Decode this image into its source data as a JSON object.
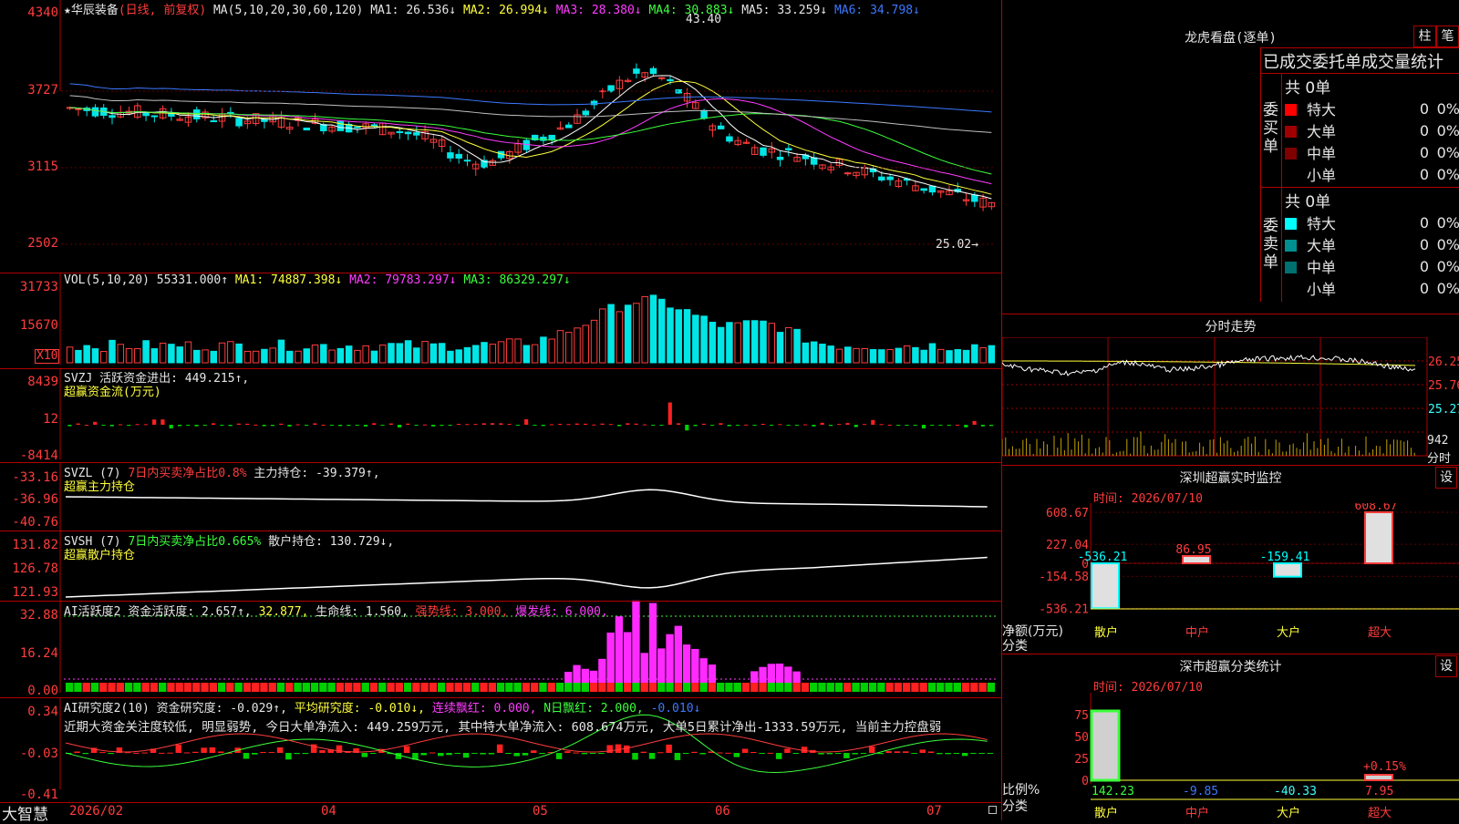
{
  "stock": {
    "star": "★",
    "name": "华辰装备",
    "period": "(日线, 前复权)"
  },
  "main_hdr": {
    "label": "MA(5,10,20,30,60,120)",
    "ma1": "MA1: 26.536↓",
    "ma2": "MA2: 26.994↓",
    "ma3": "MA3: 28.380↓",
    "ma4": "MA4: 30.883↓",
    "ma5": "MA5: 33.259↓",
    "ma6": "MA6: 34.798↓"
  },
  "price_axis": [
    "4340",
    "3727",
    "3115",
    "2502"
  ],
  "price_marks": {
    "high": "43.40",
    "low": "25.02→"
  },
  "vol_hdr": {
    "label": "VOL(5,10,20)",
    "val": "55331.000↑",
    "ma1": "MA1: 74887.398↓",
    "ma2": "MA2: 79783.297↓",
    "ma3": "MA3: 86329.297↓"
  },
  "vol_axis": [
    "31733",
    "15670"
  ],
  "vol_unit": "X10",
  "svzj": {
    "label": "SVZJ",
    "desc": "活跃资金进出: 449.215↑,",
    "sub": "超赢资金流(万元)",
    "axis": [
      "8439",
      "12",
      "-8414"
    ]
  },
  "svzl": {
    "label": "SVZL (7)",
    "ratio": "7日内买卖净占比0.8%",
    "val": "主力持仓: -39.379↑,",
    "sub": "超赢主力持仓",
    "axis": [
      "-33.16",
      "-36.96",
      "-40.76"
    ]
  },
  "svsh": {
    "label": "SVSH (7)",
    "ratio": "7日内买卖净占比0.665%",
    "val": "散户持仓: 130.729↓,",
    "sub": "超赢散户持仓",
    "axis": [
      "131.82",
      "126.78",
      "121.93"
    ]
  },
  "ai1": {
    "label": "AI活跃度2",
    "v1": "资金活跃度: 2.657↑,",
    "v2": "32.877,",
    "v3": "生命线: 1.560,",
    "v4": "强势线: 3.000,",
    "v5": "爆发线: 6.000,",
    "axis": [
      "32.88",
      "16.24",
      "0.00"
    ]
  },
  "ai2": {
    "label": "AI研究度2(10)",
    "v1": "资金研究度: -0.029↑,",
    "v2": "平均研究度: -0.010↓,",
    "v3": "连续飘红: 0.000,",
    "v4": "N日飘红: 2.000,",
    "v5": "-0.010↓",
    "desc": "近期大资金关注度较低, 明显弱势, 今日大单净流入: 449.259万元, 其中特大单净流入: 608.674万元, 大单5日累计净出-1333.59万元, 当前主力控盘弱",
    "axis": [
      "0.34",
      "-0.03",
      "-0.41"
    ]
  },
  "brand": "大智慧",
  "dates": [
    "2026/02",
    "04",
    "05",
    "06",
    "07"
  ],
  "right": {
    "lhb_title": "龙虎看盘(逐单)",
    "btn1": "柱",
    "btn2": "笔",
    "stat_title": "已成交委托单成交量统计",
    "buy_label": "委买单",
    "sell_label": "委卖单",
    "buy_total": "共 0单",
    "sell_total": "共 0单",
    "rows": [
      {
        "name": "特大",
        "val": "0",
        "pct": "0%"
      },
      {
        "name": "大单",
        "val": "0",
        "pct": "0%"
      },
      {
        "name": "中单",
        "val": "0",
        "pct": "0%"
      },
      {
        "name": "小单",
        "val": "0",
        "pct": "0%"
      }
    ],
    "buy_colors": [
      "#ff0000",
      "#a00000",
      "#800000",
      ""
    ],
    "sell_colors": [
      "#00ffff",
      "#009090",
      "#007070",
      ""
    ],
    "fs_title": "分时走势",
    "fs_axis": [
      "26.25",
      "25.76",
      "25.27"
    ],
    "fs_vol": "942",
    "fs_unit": "分时",
    "sz_title": "深圳超赢实时监控",
    "sz_btn": "设",
    "sz_date": "时间: 2026/07/10",
    "sz_axis": [
      "608.67",
      "227.04",
      "0",
      "-154.58",
      "-536.21"
    ],
    "sz_vals": [
      "-536.21",
      "86.95",
      "-159.41",
      "608.67"
    ],
    "sz_ylabel": "净额(万元)",
    "sz_xlabel": "分类",
    "cats": [
      "散户",
      "中户",
      "大户",
      "超大"
    ],
    "fl_title": "深市超赢分类统计",
    "fl_btn": "设",
    "fl_date": "时间: 2026/07/10",
    "fl_axis": [
      "75",
      "50",
      "25",
      "0"
    ],
    "fl_pct": "+0.15%",
    "fl_vals": [
      "142.23",
      "-9.85",
      "-40.33",
      "7.95"
    ],
    "fl_ylabel": "比例%",
    "fl_xlabel": "分类"
  }
}
